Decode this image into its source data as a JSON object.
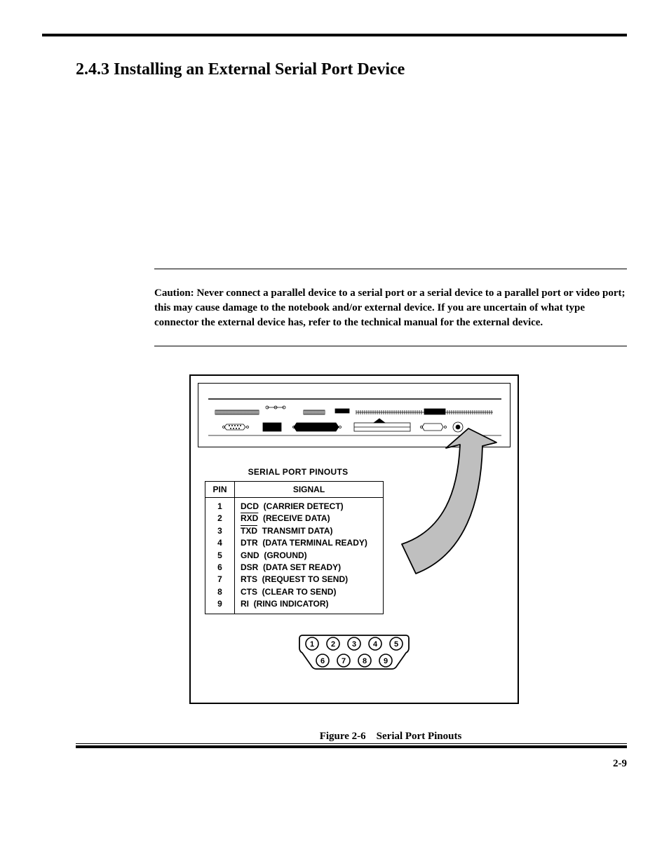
{
  "section": {
    "number": "2.4.3",
    "title": "Installing an External Serial Port Device"
  },
  "caution": {
    "label": "Caution:",
    "text": "Never connect a parallel device to a serial port or a serial device to a parallel port or video port; this may cause damage to the notebook and/or external device. If you are uncertain of what type connector the external device has, refer to the technical manual for the external device."
  },
  "pinout": {
    "title": "SERIAL PORT PINOUTS",
    "headers": {
      "pin": "PIN",
      "signal": "SIGNAL"
    },
    "rows": [
      {
        "pin": "1",
        "code": "DCD",
        "desc": "(CARRIER DETECT)",
        "overline": false
      },
      {
        "pin": "2",
        "code": "RXD",
        "desc": "(RECEIVE DATA)",
        "overline": true
      },
      {
        "pin": "3",
        "code": "TXD",
        "desc": "TRANSMIT DATA)",
        "overline": true
      },
      {
        "pin": "4",
        "code": "DTR",
        "desc": "(DATA TERMINAL READY)",
        "overline": false
      },
      {
        "pin": "5",
        "code": "GND",
        "desc": "(GROUND)",
        "overline": false
      },
      {
        "pin": "6",
        "code": "DSR",
        "desc": "(DATA SET READY)",
        "overline": false
      },
      {
        "pin": "7",
        "code": "RTS",
        "desc": "(REQUEST TO SEND)",
        "overline": false
      },
      {
        "pin": "8",
        "code": "CTS",
        "desc": "(CLEAR TO SEND)",
        "overline": false
      },
      {
        "pin": "9",
        "code": "RI",
        "desc": "(RING INDICATOR)",
        "overline": false
      }
    ]
  },
  "connector_pins": [
    "1",
    "2",
    "3",
    "4",
    "5",
    "6",
    "7",
    "8",
    "9"
  ],
  "figure": {
    "label": "Figure 2-6",
    "title": "Serial Port Pinouts"
  },
  "page_number": "2-9"
}
